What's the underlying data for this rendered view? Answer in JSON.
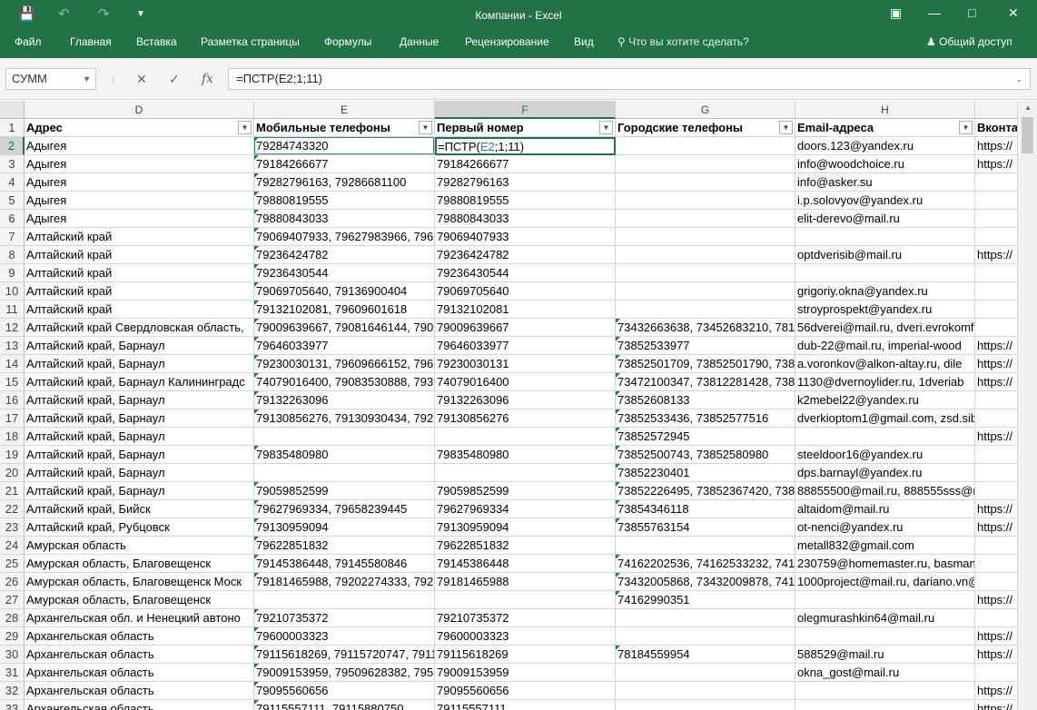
{
  "window": {
    "title": "Компании - Excel"
  },
  "ribbon_tabs": [
    "Файл",
    "Главная",
    "Вставка",
    "Разметка страницы",
    "Формулы",
    "Данные",
    "Рецензирование",
    "Вид"
  ],
  "tell_me": "Что вы хотите сделать?",
  "share": "Общий доступ",
  "name_box": "СУММ",
  "formula_bar": "=ПСТР(E2;1;11)",
  "columns": [
    "D",
    "E",
    "F",
    "G",
    "H",
    ""
  ],
  "header_row": [
    "Адрес",
    "Мобильные телефоны",
    "Первый номер",
    "Городские телефоны",
    "Email-адреса",
    "Вконта"
  ],
  "active_cell_parts": {
    "a": "=ПСТР(",
    "b": "E2",
    "c": ";1;11)"
  },
  "rows": [
    {
      "n": "2",
      "d": "Адыгея",
      "e": "79284743320",
      "f": "",
      "g": "",
      "h": "doors.123@yandex.ru",
      "i": "https://"
    },
    {
      "n": "3",
      "d": "Адыгея",
      "e": "79184266677",
      "f": "79184266677",
      "g": "",
      "h": "info@woodchoice.ru",
      "i": "https://"
    },
    {
      "n": "4",
      "d": "Адыгея",
      "e": "79282796163, 79286681100",
      "f": "79282796163",
      "g": "",
      "h": "info@asker.su",
      "i": ""
    },
    {
      "n": "5",
      "d": "Адыгея",
      "e": "79880819555",
      "f": "79880819555",
      "g": "",
      "h": "i.p.solovyov@yandex.ru",
      "i": ""
    },
    {
      "n": "6",
      "d": "Адыгея",
      "e": "79880843033",
      "f": "79880843033",
      "g": "",
      "h": "elit-derevo@mail.ru",
      "i": ""
    },
    {
      "n": "7",
      "d": "Алтайский край",
      "e": "79069407933, 79627983966, 7962",
      "f": "79069407933",
      "g": "",
      "h": "",
      "i": ""
    },
    {
      "n": "8",
      "d": "Алтайский край",
      "e": "79236424782",
      "f": "79236424782",
      "g": "",
      "h": "optdverisib@mail.ru",
      "i": "https://"
    },
    {
      "n": "9",
      "d": "Алтайский край",
      "e": "79236430544",
      "f": "79236430544",
      "g": "",
      "h": "",
      "i": ""
    },
    {
      "n": "10",
      "d": "Алтайский край",
      "e": "79069705640, 79136900404",
      "f": "79069705640",
      "g": "",
      "h": "grigoriy.okna@yandex.ru",
      "i": ""
    },
    {
      "n": "11",
      "d": "Алтайский край",
      "e": "79132102081, 79609601618",
      "f": "79132102081",
      "g": "",
      "h": "stroyprospekt@yandex.ru",
      "i": ""
    },
    {
      "n": "12",
      "d": "Алтайский край Свердловская область,",
      "e": "79009639667, 79081646144, 7909",
      "f": "79009639667",
      "g": "73432663638, 73452683210, 7812",
      "h": "56dverei@mail.ru, dveri.evrokomfort@",
      "i": ""
    },
    {
      "n": "13",
      "d": "Алтайский край, Барнаул",
      "e": "79646033977",
      "f": "79646033977",
      "g": "73852533977",
      "h": "dub-22@mail.ru, imperial-wood",
      "i": "https://"
    },
    {
      "n": "14",
      "d": "Алтайский край, Барнаул",
      "e": "79230030131, 79609666152, 7961",
      "f": "79230030131",
      "g": "73852501709, 73852501790, 7385",
      "h": "a.voronkov@alkon-altay.ru, dile",
      "i": "https://"
    },
    {
      "n": "15",
      "d": "Алтайский край, Барнаул Калининградс",
      "e": "74079016400, 79083530888, 7937",
      "f": "74079016400",
      "g": "73472100347, 73812281428, 7381",
      "h": "1130@dvernoylider.ru, 1dveriab",
      "i": "https://"
    },
    {
      "n": "16",
      "d": "Алтайский край, Барнаул",
      "e": "79132263096",
      "f": "79132263096",
      "g": "73852608133",
      "h": "k2mebel22@yandex.ru",
      "i": ""
    },
    {
      "n": "17",
      "d": "Алтайский край, Барнаул",
      "e": "79130856276, 79130930434, 7929",
      "f": "79130856276",
      "g": "73852533436, 73852577516",
      "h": "dverkioptom1@gmail.com, zsd.sibir@g",
      "i": ""
    },
    {
      "n": "18",
      "d": "Алтайский край, Барнаул",
      "e": "",
      "f": "",
      "g": "73852572945",
      "h": "",
      "i": "https://"
    },
    {
      "n": "19",
      "d": "Алтайский край, Барнаул",
      "e": "79835480980",
      "f": "79835480980",
      "g": "73852500743, 73852580980",
      "h": "steeldoor16@yandex.ru",
      "i": ""
    },
    {
      "n": "20",
      "d": "Алтайский край, Барнаул",
      "e": "",
      "f": "",
      "g": "73852230401",
      "h": "dps.barnayl@yandex.ru",
      "i": ""
    },
    {
      "n": "21",
      "d": "Алтайский край, Барнаул",
      "e": "79059852599",
      "f": "79059852599",
      "g": "73852226495, 73852367420, 7385",
      "h": "88855500@mail.ru, 888555sss@mail.ru",
      "i": ""
    },
    {
      "n": "22",
      "d": "Алтайский край, Бийск",
      "e": "79627969334, 79658239445",
      "f": "79627969334",
      "g": "73854346118",
      "h": "altaidom@mail.ru",
      "i": "https://"
    },
    {
      "n": "23",
      "d": "Алтайский край, Рубцовск",
      "e": "79130959094",
      "f": "79130959094",
      "g": "73855763154",
      "h": "ot-nenci@yandex.ru",
      "i": "https://"
    },
    {
      "n": "24",
      "d": "Амурская область",
      "e": "79622851832",
      "f": "79622851832",
      "g": "",
      "h": "metall832@gmail.com",
      "i": ""
    },
    {
      "n": "25",
      "d": "Амурская область, Благовещенск",
      "e": "79145386448, 79145580846",
      "f": "79145386448",
      "g": "74162202536, 74162533232, 7416",
      "h": "230759@homemaster.ru, basmanov@h",
      "i": ""
    },
    {
      "n": "26",
      "d": "Амурская область, Благовещенск Моск",
      "e": "79181465988, 79202274333, 7925",
      "f": "79181465988",
      "g": "73432005868, 73432009878, 7416",
      "h": "1000project@mail.ru, dariano.vn@gma",
      "i": ""
    },
    {
      "n": "27",
      "d": "Амурская область, Благовещенск",
      "e": "",
      "f": "",
      "g": "74162990351",
      "h": "",
      "i": "https://"
    },
    {
      "n": "28",
      "d": "Архангельская обл. и Ненецкий автоно",
      "e": "79210735372",
      "f": "79210735372",
      "g": "",
      "h": "olegmurashkin64@mail.ru",
      "i": ""
    },
    {
      "n": "29",
      "d": "Архангельская область",
      "e": "79600003323",
      "f": "79600003323",
      "g": "",
      "h": "",
      "i": "https://"
    },
    {
      "n": "30",
      "d": "Архангельская область",
      "e": "79115618269, 79115720747, 7911",
      "f": "79115618269",
      "g": "78184559954",
      "h": "588529@mail.ru",
      "i": "https://"
    },
    {
      "n": "31",
      "d": "Архангельская область",
      "e": "79009153959, 79509628382, 7953",
      "f": "79009153959",
      "g": "",
      "h": "okna_gost@mail.ru",
      "i": ""
    },
    {
      "n": "32",
      "d": "Архангельская область",
      "e": "79095560656",
      "f": "79095560656",
      "g": "",
      "h": "",
      "i": "https://"
    },
    {
      "n": "33",
      "d": "Архангельская область",
      "e": "79115557111, 79115880750",
      "f": "79115557111",
      "g": "",
      "h": "",
      "i": "https://"
    }
  ]
}
